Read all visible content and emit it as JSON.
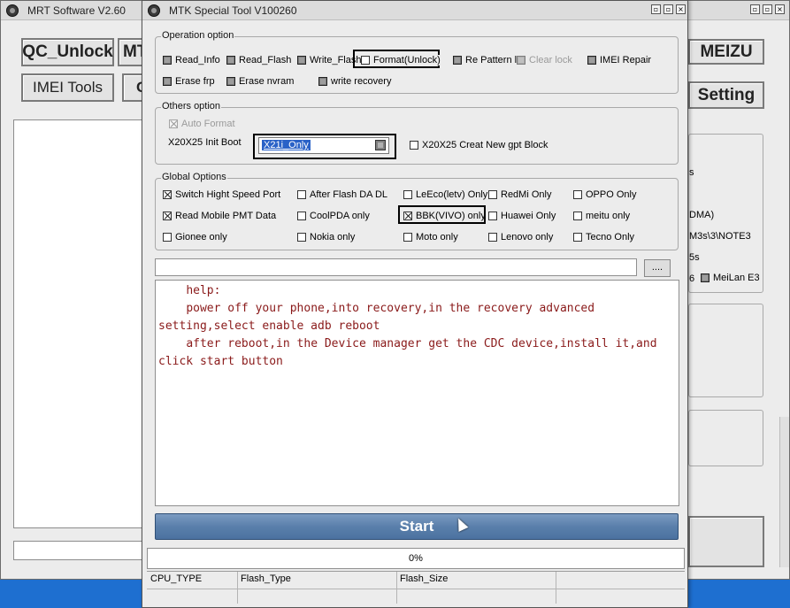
{
  "background_window": {
    "title": "MRT Software V2.60",
    "buttons": {
      "qc_unlock": "QC_Unlock",
      "mtk_partial": "MT",
      "imei_tools": "IMEI Tools",
      "c_partial": "C",
      "meizu": "MEIZU",
      "setting": "Setting"
    },
    "partial_texts": {
      "s_text": "s",
      "dma_text": "DMA)",
      "m3s_text": "M3s\\3\\NOTE3",
      "five_s_text": "5s",
      "six_text": "6",
      "meilan_e3": "MeiLan E3"
    }
  },
  "dialog": {
    "title": "MTK Special Tool V100260",
    "operation_option": {
      "legend": "Operation option",
      "options": [
        {
          "label": "Read_Info",
          "state": "dark"
        },
        {
          "label": "Read_Flash",
          "state": "dark"
        },
        {
          "label": "Write_Flash",
          "state": "dark"
        },
        {
          "label": "Format(Unlock)",
          "state": "unchecked",
          "highlighted": true
        },
        {
          "label": "Re Pattern lock",
          "state": "dark"
        },
        {
          "label": "Clear lock",
          "state": "disabled"
        },
        {
          "label": "IMEI Repair",
          "state": "dark"
        },
        {
          "label": "Erase frp",
          "state": "dark"
        },
        {
          "label": "Erase nvram",
          "state": "dark"
        },
        {
          "label": "write recovery",
          "state": "dark"
        }
      ]
    },
    "others_option": {
      "legend": "Others option",
      "auto_format": {
        "label": "Auto Format",
        "checked": true,
        "disabled": true
      },
      "init_boot_label": "X20X25 Init Boot",
      "init_boot_value": "X21i_Only",
      "creat_gpt": {
        "label": "X20X25 Creat New gpt Block",
        "checked": false
      }
    },
    "global_options": {
      "legend": "Global Options",
      "options": [
        {
          "label": "Switch Hight Speed Port",
          "checked": true
        },
        {
          "label": "After Flash DA DL",
          "checked": false
        },
        {
          "label": "LeEco(letv) Only",
          "checked": false
        },
        {
          "label": "RedMi Only",
          "checked": false
        },
        {
          "label": "OPPO Only",
          "checked": false
        },
        {
          "label": "Read Mobile PMT Data",
          "checked": true
        },
        {
          "label": "CoolPDA only",
          "checked": false
        },
        {
          "label": "BBK(VIVO) only",
          "checked": true,
          "highlighted": true
        },
        {
          "label": "Huawei Only",
          "checked": false
        },
        {
          "label": "meitu only",
          "checked": false
        },
        {
          "label": "Gionee only",
          "checked": false
        },
        {
          "label": "Nokia only",
          "checked": false
        },
        {
          "label": "Moto only",
          "checked": false
        },
        {
          "label": "Lenovo only",
          "checked": false
        },
        {
          "label": "Tecno Only",
          "checked": false
        }
      ]
    },
    "path_input_value": "",
    "browse_label": "....",
    "help_text": "    help:\n    power off your phone,into recovery,in the recovery advanced setting,select enable adb reboot\n    after reboot,in the Device manager get the CDC device,install it,and click start button",
    "start_label": "Start",
    "progress": {
      "value": 0,
      "text": "0%"
    },
    "info_table": {
      "columns": [
        "CPU_TYPE",
        "Flash_Type",
        "Flash_Size",
        ""
      ],
      "row": [
        "",
        "",
        "",
        ""
      ]
    }
  },
  "colors": {
    "desktop": "#1e6fd0",
    "dialog_bg": "#ececec",
    "start_button": "#5a7fab",
    "help_text": "#8a1a1a",
    "selection": "#2a62c7"
  },
  "icons": [
    "app-icon",
    "minimize-icon",
    "maximize-icon",
    "close-icon",
    "mouse-cursor-icon",
    "dropdown-arrow-icon"
  ]
}
